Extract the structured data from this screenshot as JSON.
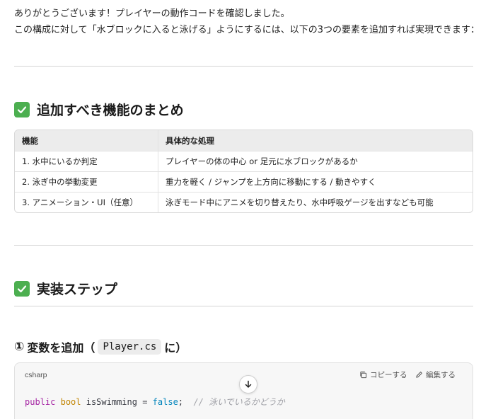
{
  "intro": {
    "line1": "ありがとうございます！プレイヤーの動作コードを確認しました。",
    "line2": "この構成に対して「水ブロックに入ると泳げる」ようにするには、以下の3つの要素を追加すれば実現できます："
  },
  "section1": {
    "title": "追加すべき機能のまとめ",
    "table": {
      "headers": [
        "機能",
        "具体的な処理"
      ],
      "rows": [
        [
          "1. 水中にいるか判定",
          "プレイヤーの体の中心 or 足元に水ブロックがあるか"
        ],
        [
          "2. 泳ぎ中の挙動変更",
          "重力を軽く / ジャンプを上方向に移動にする / 動きやすく"
        ],
        [
          "3. アニメーション・UI（任意）",
          "泳ぎモード中にアニメを切り替えたり、水中呼吸ゲージを出すなども可能"
        ]
      ]
    }
  },
  "section2": {
    "title": "実装ステップ"
  },
  "step1": {
    "number": "①",
    "title_before": "変数を追加",
    "paren_open": "（",
    "code": "Player.cs",
    "suffix": "に）"
  },
  "codeblock": {
    "language": "csharp",
    "copy_label": "コピーする",
    "edit_label": "編集する",
    "tokens": {
      "kw": "public",
      "type": "bool",
      "ident": "isSwimming",
      "eq": " = ",
      "literal": "false",
      "semi": ";",
      "comment": "// 泳いでいるかどうか"
    }
  },
  "colors": {
    "check_green": "#4caf50",
    "keyword": "#a626a4",
    "type": "#c18401",
    "literal": "#0184bc",
    "comment": "#a0a1a7"
  },
  "icons": [
    "check-icon",
    "copy-icon",
    "edit-icon",
    "arrow-down-icon"
  ]
}
